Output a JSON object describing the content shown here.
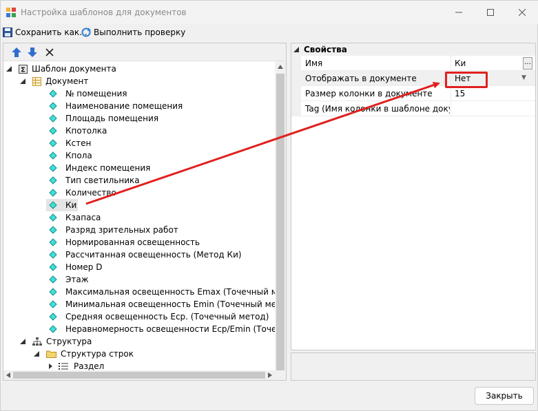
{
  "window": {
    "title": "Настройка шаблонов для документов",
    "accent_color": "#e0201e"
  },
  "toolbar": {
    "save_label": "Сохранить как...",
    "check_label": "Выполнить проверку"
  },
  "tree": {
    "root": "Шаблон документа",
    "document": "Документ",
    "items": [
      "№ помещения",
      "Наименование помещения",
      "Площадь помещения",
      "Кпотолка",
      "Кстен",
      "Кпола",
      "Индекс помещения",
      "Тип светильника",
      "Количество",
      "Ки",
      "Кзапаса",
      "Разряд зрительных работ",
      "Нормированная освещенность",
      "Рассчитанная освещенность (Метод Ки)",
      "Номер D",
      "Этаж",
      "Максимальная освещенность Emax (Точечный метод)",
      "Минимальная освещенность Emin (Точечный метод)",
      "Средняя освещенность Eср. (Точечный метод)",
      "Неравномерность освещенности Eср/Emin (Точечный метод)"
    ],
    "selected_index": 9,
    "structure": "Структура",
    "row_structure": "Структура строк",
    "section": "Раздел"
  },
  "properties": {
    "category": "Свойства",
    "rows": [
      {
        "name": "Имя",
        "value": "Ки"
      },
      {
        "name": "Отображать в документе",
        "value": "Нет"
      },
      {
        "name": "Размер колонки в документе",
        "value": "15"
      },
      {
        "name": "Tag (Имя колонки в шаблоне документа)",
        "value": ""
      }
    ]
  },
  "footer": {
    "close_label": "Закрыть"
  }
}
